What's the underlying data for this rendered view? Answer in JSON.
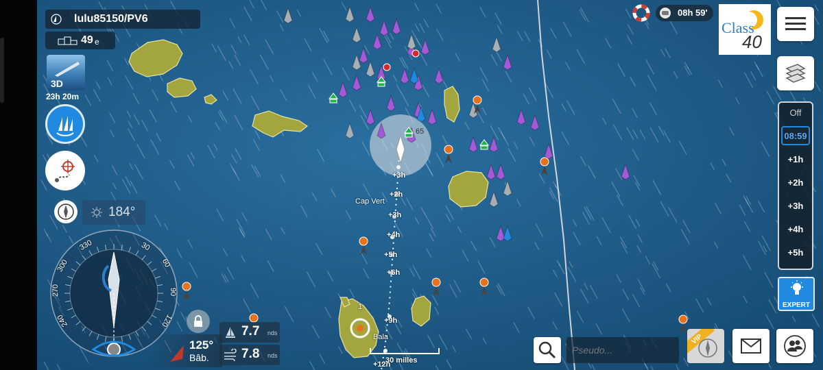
{
  "player": {
    "name": "lulu85150/PV6",
    "rank": "49",
    "rank_suffix": "e"
  },
  "view3d": {
    "label": "3D",
    "timer": "23h 20m"
  },
  "heading": {
    "value": "184°"
  },
  "header_right": {
    "timer": "08h 59'",
    "class_logo_text": "Class",
    "class_logo_number": "40"
  },
  "time_panel": {
    "off": "Off",
    "current": "08:59",
    "steps": [
      "+1h",
      "+2h",
      "+3h",
      "+4h",
      "+5h"
    ]
  },
  "expert": {
    "label": "EXPERT"
  },
  "twa": {
    "value": "125°",
    "side": "Bâb."
  },
  "speeds": {
    "boat_speed": "7.7",
    "wind_speed": "7.8",
    "unit": "nds"
  },
  "search": {
    "placeholder": "Pseudo..."
  },
  "vip": {
    "label": "VIP"
  },
  "map": {
    "place_label": "Cap Vert",
    "scale_label": "30 milles",
    "route_labels": [
      "+3h",
      "+2h",
      "+3h",
      "+4h",
      "+5h",
      "+6h",
      "+9h",
      "+12h"
    ],
    "compass_numbers": [
      "330",
      "300",
      "270",
      "240",
      "30",
      "60",
      "90",
      "120"
    ],
    "partial_labels": [
      "Bala",
      "65",
      "1"
    ]
  },
  "colors": {
    "ocean": "#1d5d8c",
    "island": "#a3a63e",
    "accent_blue": "#1f8ae0",
    "orange_marker": "#e8721c",
    "purple_boat": "#a25ad6"
  }
}
